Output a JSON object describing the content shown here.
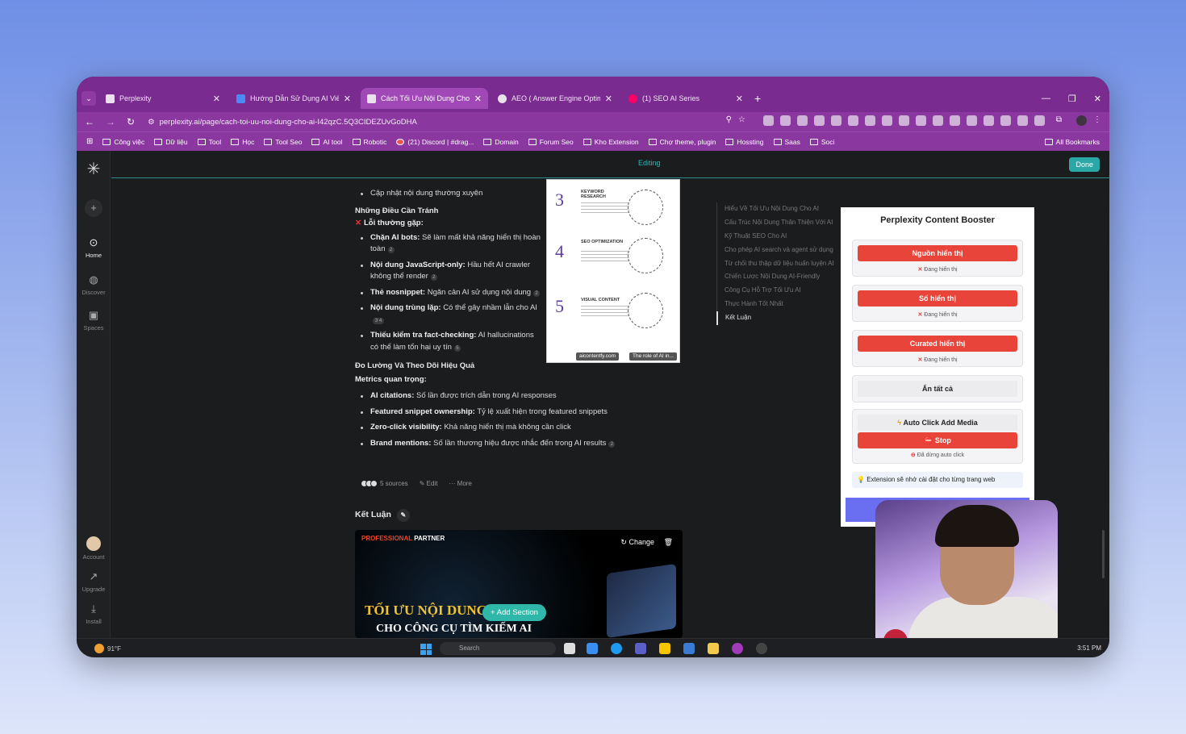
{
  "tabs": [
    {
      "title": "Perplexity",
      "active": false
    },
    {
      "title": "Hướng Dẫn Sử Dụng AI Viết Bả",
      "active": false
    },
    {
      "title": "Cách Tối Ưu Nội Dung Cho AI",
      "active": true
    },
    {
      "title": "AEO ( Answer Engine Optimiza",
      "active": false
    },
    {
      "title": "(1) SEO AI Series",
      "active": false
    }
  ],
  "address": {
    "url": "perplexity.ai/page/cach-toi-uu-noi-dung-cho-ai-I42qzC.5Q3CIDEZUvGoDHA"
  },
  "bookmarks": [
    "Công việc",
    "Dữ liệu",
    "Tool",
    "Học",
    "Tool Seo",
    "AI tool",
    "Robotic",
    "(21) Discord | #drag...",
    "Domain",
    "Forum Seo",
    "Kho Extension",
    "Chợ theme, plugin",
    "Hossting",
    "Saas",
    "Soci"
  ],
  "bookmarks_all": "All Bookmarks",
  "rail": {
    "home": "Home",
    "discover": "Discover",
    "spaces": "Spaces",
    "account": "Account",
    "upgrade": "Upgrade",
    "install": "Install"
  },
  "topbar": {
    "status": "Editing",
    "done": "Done"
  },
  "article": {
    "item_top": "Cập nhật nội dung thường xuyên",
    "avoid_heading": "Những Điều Cần Tránh",
    "errors_heading": "Lỗi thường gặp:",
    "errors": [
      {
        "bold": "Chặn AI bots:",
        "text": " Sẽ làm mất khả năng hiển thị hoàn toàn",
        "cite": "2"
      },
      {
        "bold": "Nội dung JavaScript-only:",
        "text": " Hầu hết AI crawler không thể render",
        "cite": "2"
      },
      {
        "bold": "Thẻ nosnippet:",
        "text": " Ngăn cản AI sử dụng nội dung",
        "cite": "2"
      },
      {
        "bold": "Nội dung trùng lặp:",
        "text": " Có thể gây nhầm lẫn cho AI",
        "cite": "3 4"
      },
      {
        "bold": "Thiếu kiểm tra fact-checking:",
        "text": " AI hallucinations có thể làm tổn hại uy tín",
        "cite": "5"
      }
    ],
    "measure_heading": "Đo Lường Và Theo Dõi Hiệu Quả",
    "metrics_heading": "Metrics quan trọng:",
    "metrics": [
      {
        "bold": "AI citations:",
        "text": " Số lần được trích dẫn trong AI responses"
      },
      {
        "bold": "Featured snippet ownership:",
        "text": " Tỷ lệ xuất hiện trong featured snippets"
      },
      {
        "bold": "Zero-click visibility:",
        "text": " Khả năng hiển thị mà không cần click"
      },
      {
        "bold": "Brand mentions:",
        "text": " Số lần thương hiệu được nhắc đến trong AI results",
        "cite": "2"
      }
    ],
    "sources": "5 sources",
    "edit": "Edit",
    "more": "More",
    "conclusion": "Kết Luận"
  },
  "infographic": {
    "items": [
      {
        "num": "3",
        "label": "KEYWORD RESEARCH"
      },
      {
        "num": "4",
        "label": "SEO OPTIMIZATION"
      },
      {
        "num": "5",
        "label": "VISUAL CONTENT"
      }
    ],
    "cap1": "aicontentfy.com",
    "cap2": "The role of AI in..."
  },
  "toc": [
    "Hiểu Về Tối Ưu Nội Dung Cho AI",
    "Cấu Trúc Nội Dung Thân Thiện Với AI",
    "Kỹ Thuật SEO Cho AI",
    "Cho phép AI search và agent sử dụng",
    "Từ chối thu thập dữ liệu huấn luyện AI",
    "Chiến Lược Nội Dung AI-Friendly",
    "Công Cụ Hỗ Trợ Tối Ưu AI",
    "Thực Hành Tốt Nhất",
    "Kết Luận"
  ],
  "banner": {
    "pro": "PROFESSIONAL",
    "partner": "PARTNER",
    "change": "Change",
    "line1": "TỐI ƯU NỘI DUNG",
    "line2": "CHO CÔNG CỤ TÌM KIẾM AI",
    "add_section": "+ Add Section"
  },
  "extension": {
    "title": "Perplexity Content Booster",
    "buttons": [
      "Nguồn hiển thị",
      "Số hiển thị",
      "Curated hiển thị"
    ],
    "status": "Đang hiển thị",
    "hide_all": "Ẩn tất cả",
    "auto_click": "Auto Click Add Media",
    "stop": "Stop",
    "stopped": "Đã dừng auto click",
    "tip": "Extension sẽ nhớ cài đặt cho từng trang web"
  },
  "taskbar": {
    "weather": "91°F",
    "search": "Search",
    "time": "3:51 PM"
  }
}
